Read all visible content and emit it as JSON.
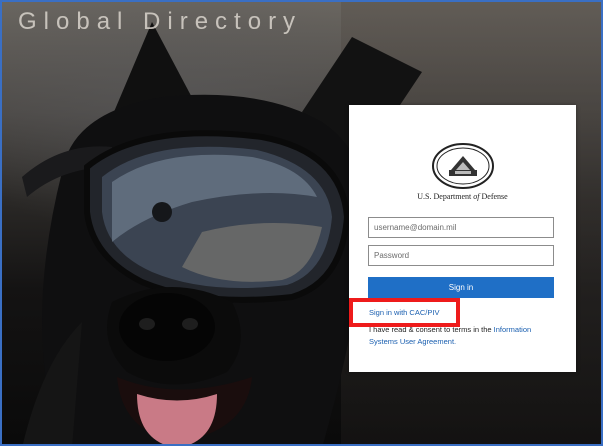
{
  "app": {
    "title": "Global Directory"
  },
  "login": {
    "organization_prefix": "U.S. Department",
    "organization_of": "of",
    "organization_suffix": "Defense",
    "username_placeholder": "username@domain.mil",
    "password_placeholder": "Password",
    "sign_in_label": "Sign in",
    "cac_link_label": "Sign in with CAC/PIV",
    "consent_text": "I have read & consent to terms in the ",
    "consent_link": "Information Systems User Agreement.",
    "username_value": "",
    "password_value": ""
  },
  "colors": {
    "accent": "#1f6fc6",
    "link": "#1a5fb0",
    "highlight": "#ee1b1b",
    "frame_border": "#3a6fc4"
  },
  "icons": {
    "seal": "pentagon-seal-icon"
  }
}
